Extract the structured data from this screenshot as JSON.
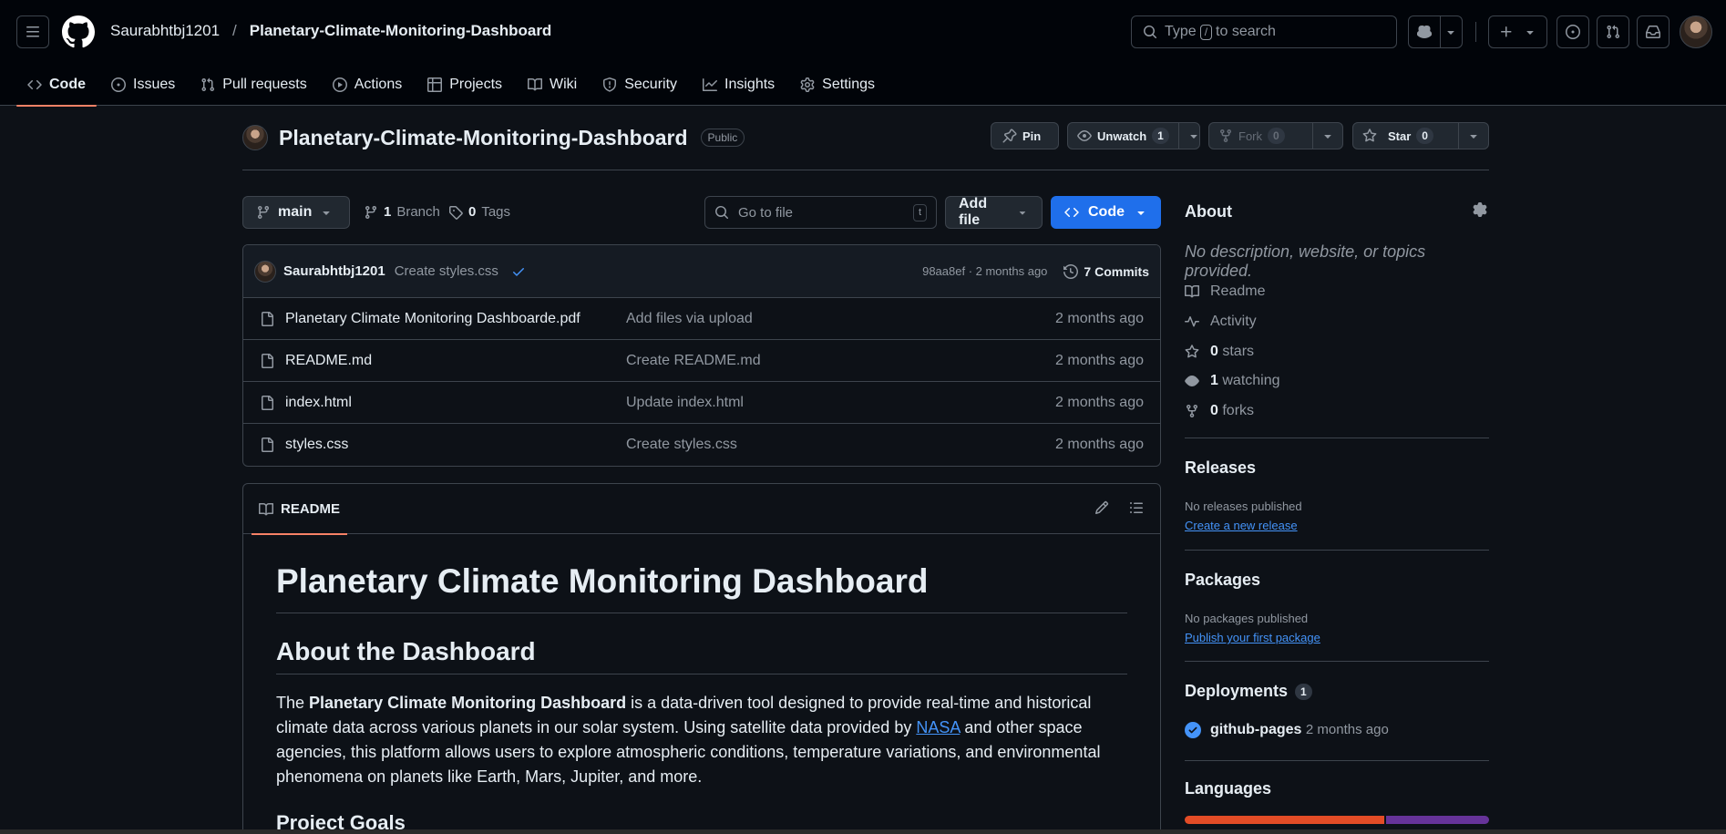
{
  "header": {
    "owner": "Saurabhtbj1201",
    "separator": "/",
    "repo": "Planetary-Climate-Monitoring-Dashboard",
    "search_prefix": "Type",
    "search_key": "/",
    "search_suffix": "to search"
  },
  "repo_nav": [
    {
      "label": "Code",
      "icon": "code-icon",
      "active": true
    },
    {
      "label": "Issues",
      "icon": "issue-opened-icon"
    },
    {
      "label": "Pull requests",
      "icon": "git-pull-request-icon"
    },
    {
      "label": "Actions",
      "icon": "play-icon"
    },
    {
      "label": "Projects",
      "icon": "table-icon"
    },
    {
      "label": "Wiki",
      "icon": "book-icon"
    },
    {
      "label": "Security",
      "icon": "shield-icon"
    },
    {
      "label": "Insights",
      "icon": "graph-icon"
    },
    {
      "label": "Settings",
      "icon": "gear-icon"
    }
  ],
  "repo_header": {
    "name": "Planetary-Climate-Monitoring-Dashboard",
    "visibility": "Public",
    "pin_label": "Pin",
    "watch_label": "Unwatch",
    "watch_count": "1",
    "fork_label": "Fork",
    "fork_count": "0",
    "star_label": "Star",
    "star_count": "0"
  },
  "file_nav": {
    "branch": "main",
    "branch_count": "1",
    "branch_label": "Branch",
    "tag_count": "0",
    "tag_label": "Tags",
    "goto_placeholder": "Go to file",
    "goto_key": "t",
    "add_file_label": "Add file",
    "code_label": "Code"
  },
  "latest_commit": {
    "author": "Saurabhtbj1201",
    "message": "Create styles.css",
    "meta": "98aa8ef · 2 months ago",
    "commits_label": "7 Commits"
  },
  "files": [
    {
      "name": "Planetary Climate Monitoring Dashboarde.pdf",
      "message": "Add files via upload",
      "date": "2 months ago"
    },
    {
      "name": "README.md",
      "message": "Create README.md",
      "date": "2 months ago"
    },
    {
      "name": "index.html",
      "message": "Update index.html",
      "date": "2 months ago"
    },
    {
      "name": "styles.css",
      "message": "Create styles.css",
      "date": "2 months ago"
    }
  ],
  "readme": {
    "tab_label": "README",
    "h1": "Planetary Climate Monitoring Dashboard",
    "h2": "About the Dashboard",
    "p_the": "The ",
    "p_bold": "Planetary Climate Monitoring Dashboard",
    "p_mid": " is a data-driven tool designed to provide real-time and historical climate data across various planets in our solar system. Using satellite data provided by ",
    "p_link": "NASA",
    "p_end": " and other space agencies, this platform allows users to explore atmospheric conditions, temperature variations, and environmental phenomena on planets like Earth, Mars, Jupiter, and more.",
    "h3": "Project Goals"
  },
  "sidebar": {
    "about_title": "About",
    "about_desc": "No description, website, or topics provided.",
    "readme_link": "Readme",
    "activity_link": "Activity",
    "stars_count": "0",
    "stars_label": "stars",
    "watching_count": "1",
    "watching_label": "watching",
    "forks_count": "0",
    "forks_label": "forks",
    "releases_title": "Releases",
    "releases_empty": "No releases published",
    "releases_link": "Create a new release",
    "packages_title": "Packages",
    "packages_empty": "No packages published",
    "packages_link": "Publish your first package",
    "deployments_title": "Deployments",
    "deployments_count": "1",
    "deployment_name": "github-pages",
    "deployment_time": "2 months ago",
    "languages_title": "Languages",
    "languages": [
      {
        "color": "#e34c26",
        "share": 0.66
      },
      {
        "color": "#663399",
        "share": 0.34
      }
    ]
  },
  "colors": {
    "accent_underline": "#f78166",
    "link": "#4493f8",
    "primary_button": "#1f6feb"
  }
}
